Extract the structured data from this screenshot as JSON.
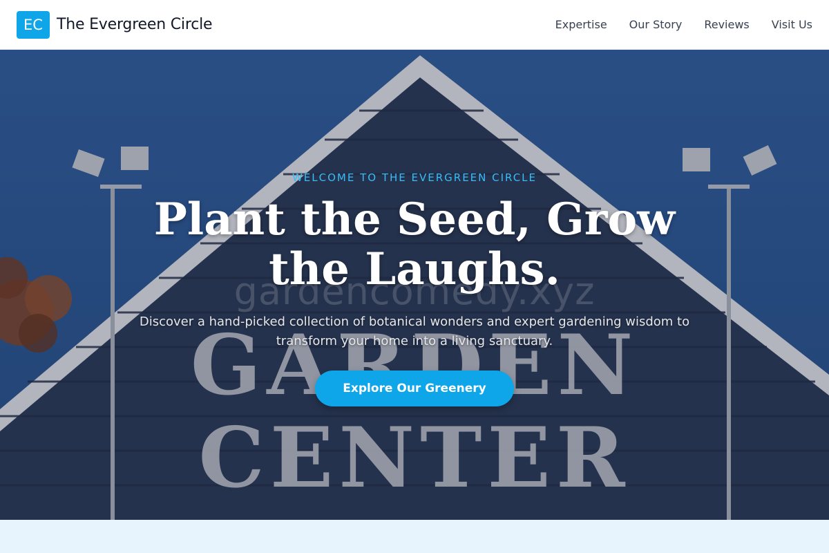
{
  "header": {
    "logo_initials": "EC",
    "brand_name": "The Evergreen Circle",
    "nav": [
      {
        "label": "Expertise"
      },
      {
        "label": "Our Story"
      },
      {
        "label": "Reviews"
      },
      {
        "label": "Visit Us"
      }
    ]
  },
  "hero": {
    "eyebrow": "WELCOME TO THE EVERGREEN CIRCLE",
    "headline": "Plant the Seed, Grow the Laughs.",
    "subtext": "Discover a hand-picked collection of botanical wonders and expert gardening wisdom to transform your home into a living sanctuary.",
    "cta_label": "Explore Our Greenery",
    "watermark": "gardencomedy.xyz",
    "sign_text": [
      "GARDEN",
      "CENTER"
    ]
  },
  "colors": {
    "accent": "#0ea5e9",
    "eyebrow": "#38bdf8",
    "page_background": "#e8f4fd",
    "header_background": "#ffffff"
  }
}
